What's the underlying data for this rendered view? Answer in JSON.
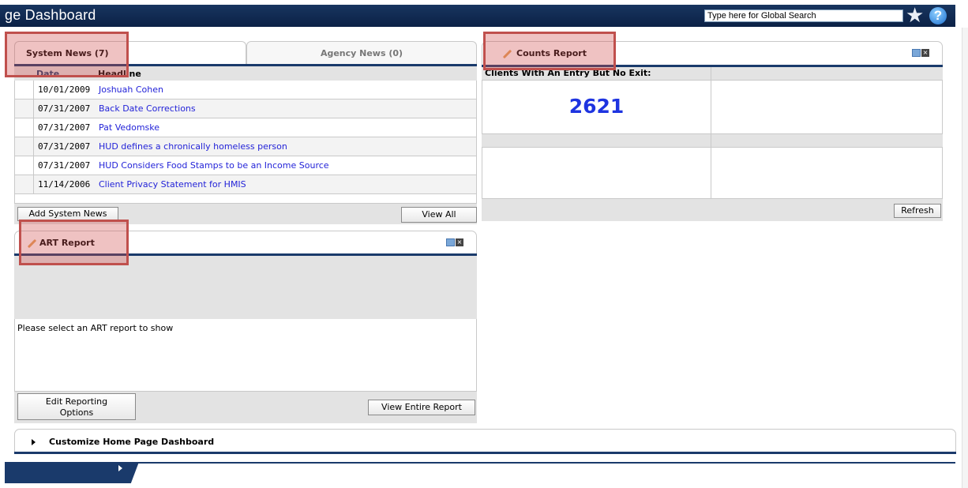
{
  "header": {
    "title": "ge Dashboard",
    "search_placeholder": "Type here for Global Search"
  },
  "news": {
    "tabs": [
      {
        "label": "System News (7)",
        "active": true
      },
      {
        "label": "Agency News (0)",
        "active": false
      }
    ],
    "columns": {
      "date": "Date",
      "headline": "Headline"
    },
    "items": [
      {
        "date": "10/01/2009",
        "headline": "Joshuah Cohen"
      },
      {
        "date": "07/31/2007",
        "headline": "Back Date Corrections"
      },
      {
        "date": "07/31/2007",
        "headline": "Pat Vedomske"
      },
      {
        "date": "07/31/2007",
        "headline": "HUD defines a chronically homeless person"
      },
      {
        "date": "07/31/2007",
        "headline": "HUD Considers Food Stamps to be an Income Source"
      },
      {
        "date": "11/14/2006",
        "headline": "Client Privacy Statement for HMIS"
      }
    ],
    "add_button": "Add System News",
    "view_all_button": "View All"
  },
  "counts": {
    "title": "Counts Report",
    "column_label": "Clients With An Entry But No Exit:",
    "value": "2621",
    "refresh_button": "Refresh"
  },
  "art": {
    "title": "ART Report",
    "message": "Please select an ART report to show",
    "edit_button_line1": "Edit Reporting",
    "edit_button_line2": "Options",
    "view_entire_button": "View Entire Report"
  },
  "customize": {
    "label": "Customize Home Page Dashboard"
  },
  "colors": {
    "header_bar": "#0b2146",
    "rule": "#1a3a6b",
    "link": "#2323d8",
    "count_value": "#1e34e0",
    "annotation": "#c0504d"
  }
}
